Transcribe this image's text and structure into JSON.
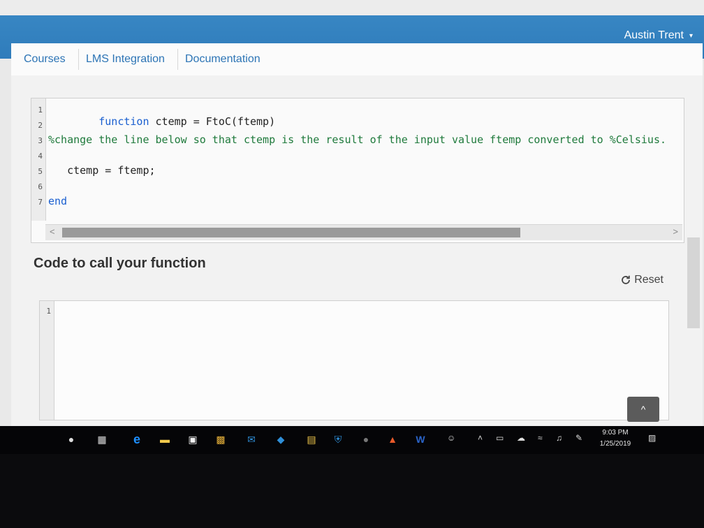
{
  "header": {
    "user_name": "Austin Trent",
    "caret": "▾"
  },
  "nav": {
    "tabs": [
      {
        "label": "Courses"
      },
      {
        "label": "LMS Integration"
      },
      {
        "label": "Documentation"
      }
    ]
  },
  "function_editor": {
    "lines": [
      {
        "num": "1",
        "text": "function ctemp = FtoC(ftemp)"
      },
      {
        "num": "2",
        "text": ""
      },
      {
        "num": "3",
        "text": "%change the line below so that ctemp is the result of the input value ftemp converted to %Celsius."
      },
      {
        "num": "4",
        "text": ""
      },
      {
        "num": "5",
        "text": "   ctemp = ftemp;"
      },
      {
        "num": "6",
        "text": ""
      },
      {
        "num": "7",
        "text": "end"
      }
    ],
    "scroll_left": "<",
    "scroll_right": ">"
  },
  "call_section": {
    "title": "Code to call your function",
    "reset_label": "Reset",
    "line_number": "1",
    "scroll_top_label": "^"
  },
  "taskbar": {
    "time": "9:03 PM",
    "date": "1/25/2019"
  }
}
